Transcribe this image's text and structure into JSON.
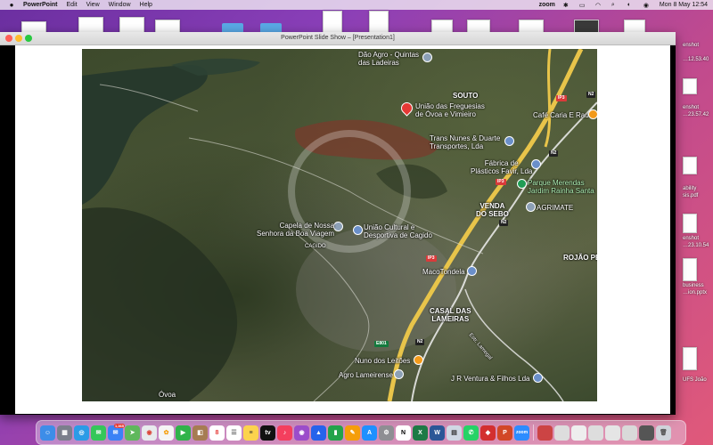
{
  "menubar": {
    "app_name": "PowerPoint",
    "menus": [
      "Edit",
      "View",
      "Window",
      "Help"
    ],
    "status_app": "zoom",
    "datetime": "Mon 8 May  12:54"
  },
  "window": {
    "title": "PowerPoint Slide Show – [Presentation1]"
  },
  "desktop": {
    "right_labels": [
      "enshot",
      "…12.53.40",
      "enshot",
      "…23.57.42",
      "ability",
      "sis.pdf",
      "enshot",
      "…23.10.54",
      "business",
      "…ion.pptx",
      "UFS João"
    ]
  },
  "map": {
    "labels": {
      "dao_agro": "Dão Agro - Quintas\ndas Ladeiras",
      "souto": "SOUTO",
      "uniao_freguesias": "União das Freguesias\nde Óvoa e Vimieiro",
      "cafe_caria": "Café Caria E Rau",
      "trans_nunes": "Trans Nunes & Duarte\nTransportes, Lda",
      "fabrica": "Fábrica de\nPlásticos Favir, Lda",
      "parque": "Parque Merendas\nJardim Rainha Santa",
      "venda_sebo": "VENDA\nDO SEBO",
      "agrimate": "AGRIMATE",
      "capela": "Capela de Nossa\nSenhora da Boa Viagem",
      "uniao_cultural": "União Cultural e\nDesportiva de Cagido",
      "cagido": "CAGIDO",
      "rojao": "ROJÃO PE",
      "macotondela": "MacoTondela",
      "casal": "CASAL DAS\nLAMEIRAS",
      "estr_lamegal": "Estr. Lamegal",
      "nuno": "Nuno dos Leitões",
      "agro_lameirense": "Agro Lameirense",
      "jr_ventura": "J R Ventura & Filhos Lda",
      "ovoa": "Óvoa"
    },
    "road_badges": {
      "ip3_a": "IP3",
      "ip3_b": "IP3",
      "ip3_c": "IP3",
      "n2_a": "N2",
      "n2_b": "N2",
      "n2_c": "N2",
      "n2_d": "N2",
      "e801": "E801"
    }
  },
  "dock": {
    "calendar_day": "8",
    "appletv": "tv",
    "zoom": "zoom",
    "mail_badge": "1,365"
  }
}
